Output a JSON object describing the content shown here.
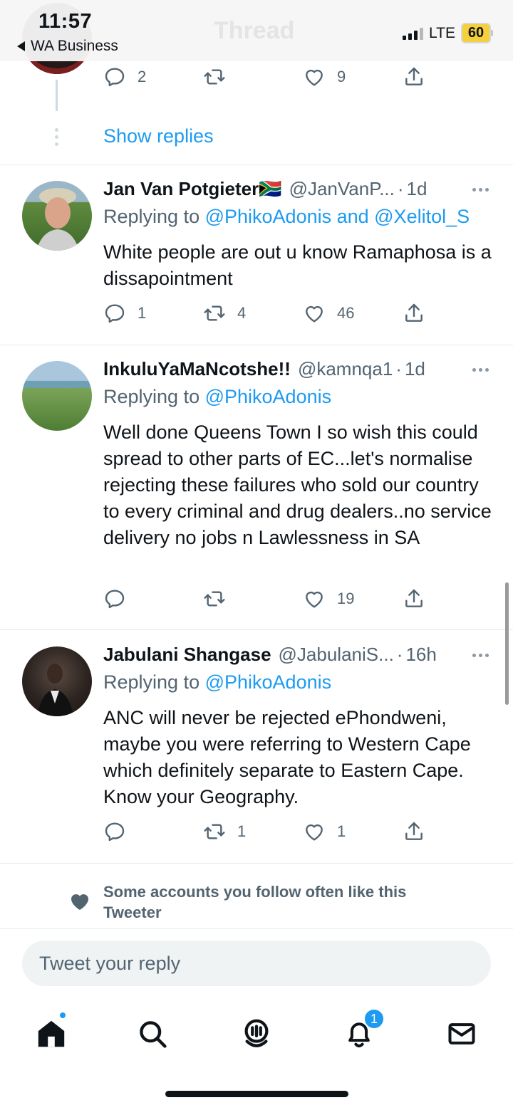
{
  "status_bar": {
    "time": "11:57",
    "back_label": "WA Business",
    "network": "LTE",
    "battery": "60",
    "ghost_title": "Thread"
  },
  "top_tweet_actions": {
    "replies": "2",
    "retweets": "",
    "likes": "9"
  },
  "show_replies_label": "Show replies",
  "tweets": [
    {
      "name": "Jan Van Potgieter🇿🇦",
      "handle": "@JanVanP...",
      "time": "1d",
      "replying_prefix": "Replying to ",
      "replying_to": "@PhikoAdonis and @Xelitol_S",
      "text": "White people are out u know Ramaphosa is a dissapointment",
      "replies": "1",
      "retweets": "4",
      "likes": "46"
    },
    {
      "name": "InkuluYaMaNcotshe!!",
      "handle": "@kamnqa1",
      "time": "1d",
      "replying_prefix": "Replying to ",
      "replying_to": "@PhikoAdonis",
      "text": "Well done Queens Town I so wish this could spread to other parts of EC...let's normalise rejecting these failures who sold our country to every  criminal and drug dealers..no service delivery no jobs n Lawlessness in SA",
      "replies": "",
      "retweets": "",
      "likes": "19"
    },
    {
      "name": "Jabulani Shangase",
      "handle": "@JabulaniS...",
      "time": "16h",
      "replying_prefix": "Replying to ",
      "replying_to": "@PhikoAdonis",
      "text": "ANC will never be rejected ePhondweni, maybe you were referring to Western Cape which definitely separate to Eastern Cape. Know your Geography.",
      "replies": "",
      "retweets": "1",
      "likes": "1"
    }
  ],
  "social_proof": "Some accounts you follow often like this Tweeter",
  "composer": {
    "placeholder": "Tweet your reply"
  },
  "tabbar": {
    "notifications_badge": "1"
  },
  "colors": {
    "accent": "#1d9bf0",
    "secondary_text": "#536471",
    "primary_text": "#0f1419"
  }
}
